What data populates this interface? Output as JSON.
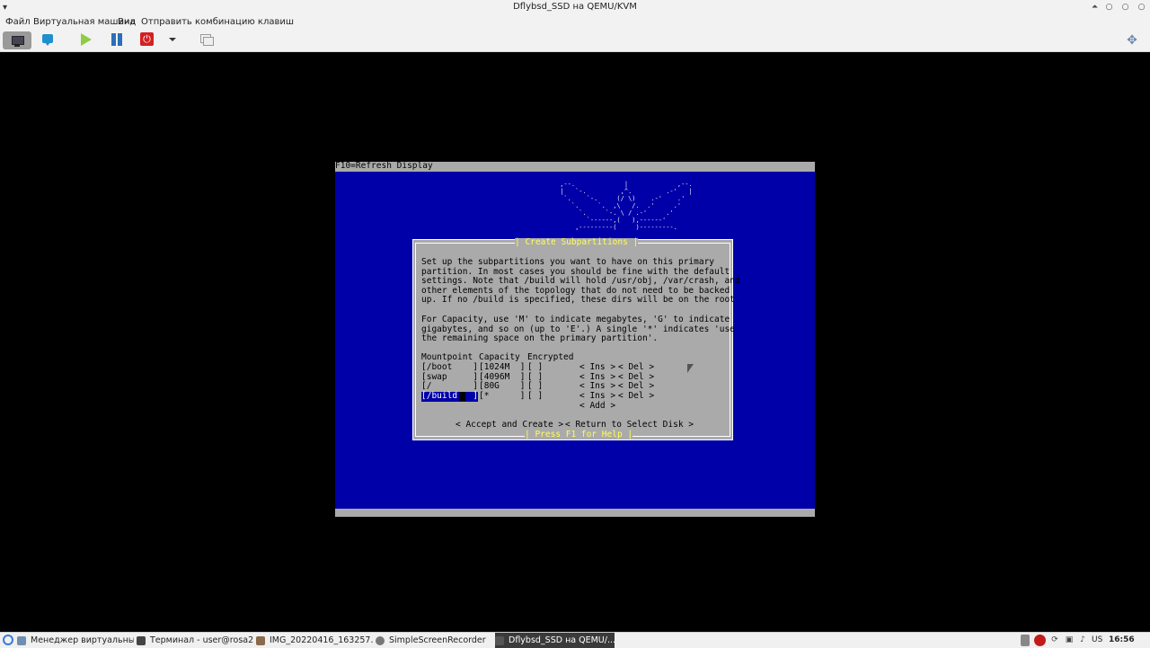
{
  "window": {
    "title": "Dflybsd_SSD на QEMU/KVM",
    "controls": [
      "⏶",
      "○",
      "○",
      "○"
    ]
  },
  "menu": [
    "Файл",
    "Виртуальная машина",
    "Вид",
    "Отправить комбинацию клавиш"
  ],
  "toolbar": {
    "icons": [
      "monitor-icon",
      "info-icon",
      "play-icon",
      "pause-icon",
      "power-icon",
      "dropdown-icon",
      "snapshot-icon",
      "resize-icon"
    ]
  },
  "vm": {
    "top_bar": "F10=Refresh Display",
    "logo_lines": [
      " ,--.             |             ,--.",
      " |   `-.         ,^.         .-'   |",
      "  `.    `-.     (/ \\)    .-'    .'",
      "    `.     `.  ,\\   /.  .'     .'",
      "      `.     `-. \\ / .-'     .'",
      "        `------,(   ),------'",
      "     ,---------(     )---------."
    ],
    "dialog": {
      "title": "| Create Subpartitions |",
      "intro": [
        "Set up the subpartitions you want to have on this primary",
        "partition. In most cases you should be fine with the default",
        "settings. Note that /build will hold /usr/obj, /var/crash, and",
        "other elements of the topology that do not need to be backed",
        "up. If no /build is specified, these dirs will be on the root."
      ],
      "capacity_note": [
        "For Capacity, use 'M' to indicate megabytes, 'G' to indicate",
        "gigabytes, and so on (up to 'E'.) A single '*' indicates 'use",
        "the remaining space on the primary partition'."
      ],
      "headers": {
        "mountpoint": "Mountpoint",
        "capacity": "Capacity",
        "encrypted": "Encrypted"
      },
      "rows": [
        {
          "mount": "[/boot    ]",
          "cap": "[1024M  ]",
          "enc": "[ ]",
          "ins": "< Ins >",
          "del": "< Del >"
        },
        {
          "mount": "[swap     ]",
          "cap": "[4096M  ]",
          "enc": "[ ]",
          "ins": "< Ins >",
          "del": "< Del >"
        },
        {
          "mount": "[/        ]",
          "cap": "[80G    ]",
          "enc": "[ ]",
          "ins": "< Ins >",
          "del": "< Del >"
        },
        {
          "mount": "[/build   ]",
          "cap": "[*      ]",
          "enc": "[ ]",
          "ins": "< Ins >",
          "del": "< Del >"
        }
      ],
      "add": "< Add >",
      "accept": "< Accept and Create >",
      "return": "< Return to Select Disk >",
      "help": "| Press F1 for Help |"
    }
  },
  "taskbar": {
    "tasks": [
      {
        "label": "Менеджер виртуальны...",
        "icon": "virt-manager-icon",
        "color": "#6f8fb0"
      },
      {
        "label": "Терминал - user@rosa20...",
        "icon": "terminal-icon",
        "color": "#444444"
      },
      {
        "label": "IMG_20220416_163257.jp...",
        "icon": "image-icon",
        "color": "#8a6a4a"
      },
      {
        "label": "SimpleScreenRecorder",
        "icon": "recorder-icon",
        "color": "#777777"
      },
      {
        "label": "Dflybsd_SSD на QEMU/...",
        "icon": "vm-icon",
        "color": "#555555"
      }
    ],
    "tray": {
      "lang": "US",
      "clock": "16:56"
    }
  }
}
